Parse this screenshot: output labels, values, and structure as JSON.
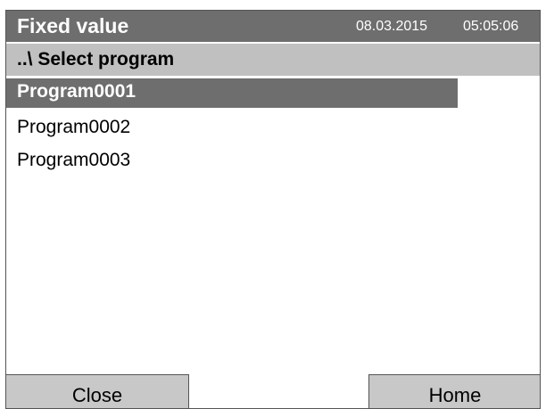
{
  "header": {
    "title": "Fixed value",
    "date": "08.03.2015",
    "time": "05:05:06"
  },
  "subheader": {
    "label": "..\\ Select program"
  },
  "programs": [
    {
      "label": "Program0001",
      "selected": true
    },
    {
      "label": "Program0002",
      "selected": false
    },
    {
      "label": "Program0003",
      "selected": false
    }
  ],
  "buttons": {
    "close": "Close",
    "home": "Home"
  },
  "colors": {
    "titlebar": "#6e6e6e",
    "subheader": "#c0c0c0",
    "selected_row": "#6e6e6e",
    "button": "#c8c8c8"
  }
}
